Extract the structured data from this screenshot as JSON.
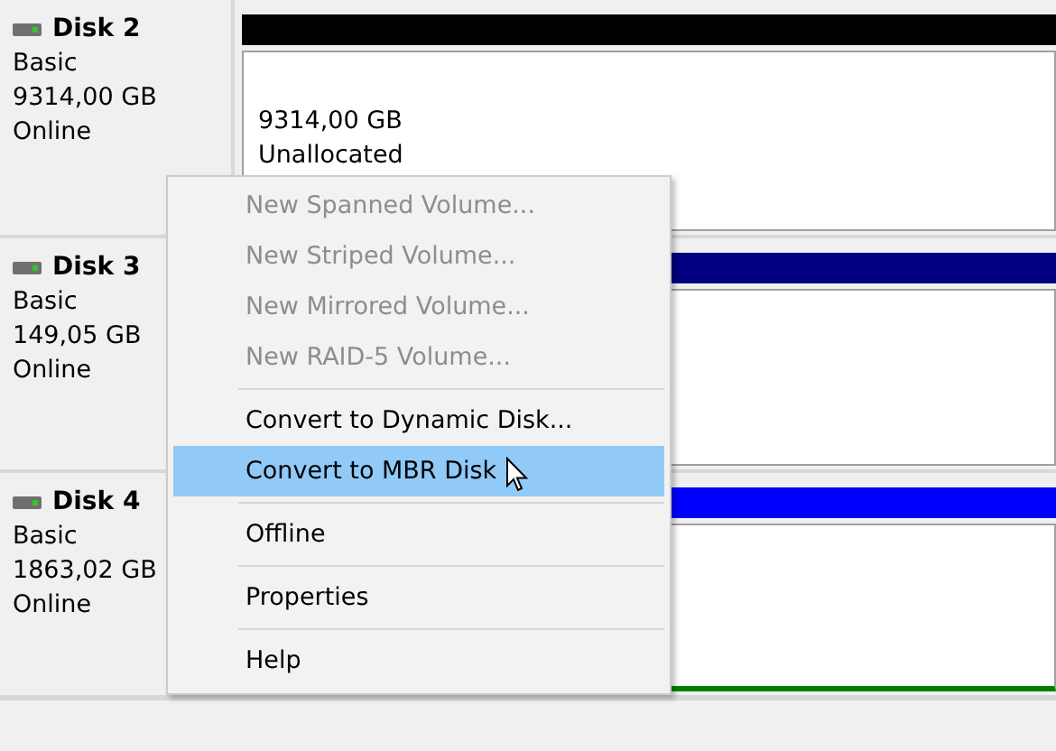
{
  "disks": [
    {
      "name": "Disk 2",
      "type": "Basic",
      "size": "9314,00 GB",
      "status": "Online",
      "color": "#000000",
      "partition": {
        "size": "9314,00 GB",
        "label": "Unallocated"
      }
    },
    {
      "name": "Disk 3",
      "type": "Basic",
      "size": "149,05 GB",
      "status": "Online",
      "color": "#000080"
    },
    {
      "name": "Disk 4",
      "type": "Basic",
      "size": "1863,02 GB",
      "status": "Online",
      "color": "#0000ff"
    }
  ],
  "context_menu": {
    "items": [
      {
        "kind": "item",
        "label": "New Spanned Volume...",
        "disabled": true,
        "selected": false
      },
      {
        "kind": "item",
        "label": "New Striped Volume...",
        "disabled": true,
        "selected": false
      },
      {
        "kind": "item",
        "label": "New Mirrored Volume...",
        "disabled": true,
        "selected": false
      },
      {
        "kind": "item",
        "label": "New RAID-5 Volume...",
        "disabled": true,
        "selected": false
      },
      {
        "kind": "separator"
      },
      {
        "kind": "item",
        "label": "Convert to Dynamic Disk...",
        "disabled": false,
        "selected": false
      },
      {
        "kind": "item",
        "label": "Convert to MBR Disk",
        "disabled": false,
        "selected": true
      },
      {
        "kind": "separator"
      },
      {
        "kind": "item",
        "label": "Offline",
        "disabled": false,
        "selected": false
      },
      {
        "kind": "separator"
      },
      {
        "kind": "item",
        "label": "Properties",
        "disabled": false,
        "selected": false
      },
      {
        "kind": "separator"
      },
      {
        "kind": "item",
        "label": "Help",
        "disabled": false,
        "selected": false
      }
    ]
  }
}
